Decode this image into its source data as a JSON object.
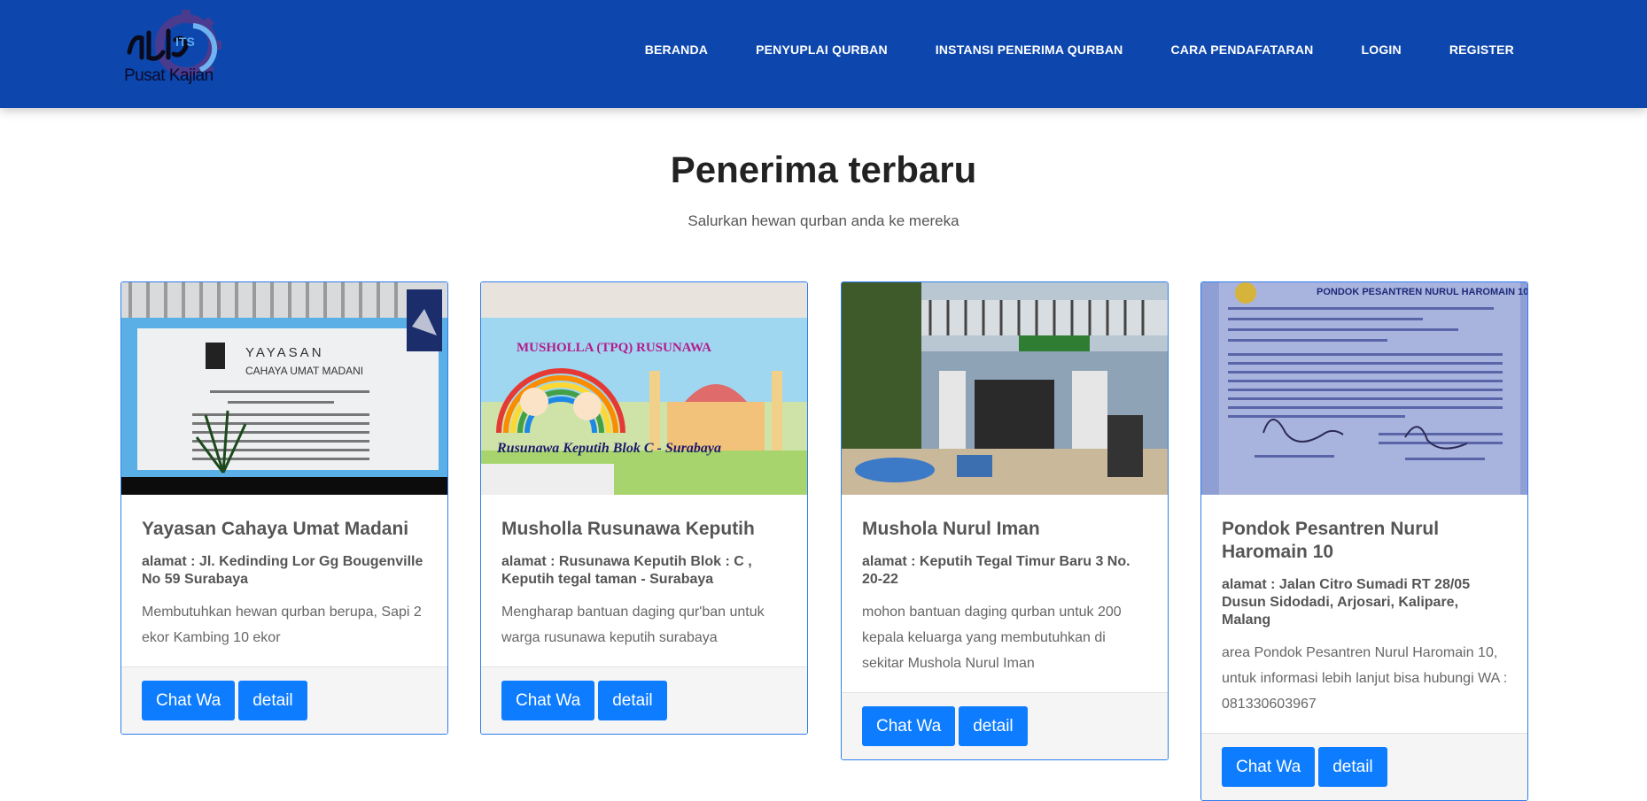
{
  "header": {
    "logo_text": "Pusat Kajian",
    "logo_badge": "ITS",
    "nav": [
      "BERANDA",
      "PENYUPLAI QURBAN",
      "INSTANSI PENERIMA QURBAN",
      "CARA PENDAFATARAN",
      "LOGIN",
      "REGISTER"
    ]
  },
  "section": {
    "title": "Penerima terbaru",
    "subtitle": "Salurkan hewan qurban anda ke mereka"
  },
  "cards": [
    {
      "title": "Yayasan Cahaya Umat Madani",
      "address": "alamat : Jl. Kedinding Lor Gg Bougenville No 59 Surabaya",
      "description": "Membutuhkan hewan qurban berupa, Sapi 2 ekor Kambing 10 ekor",
      "chat_label": "Chat Wa",
      "detail_label": "detail",
      "image_sign_title": "YAYASAN",
      "image_sign_sub": "CAHAYA UMAT MADANI"
    },
    {
      "title": "Musholla Rusunawa Keputih",
      "address": "alamat : Rusunawa Keputih Blok : C , Keputih tegal taman - Surabaya",
      "description": "Mengharap bantuan daging qur'ban untuk warga rusunawa keputih surabaya",
      "chat_label": "Chat Wa",
      "detail_label": "detail",
      "image_banner_top": "MUSHOLLA (TPQ) RUSUNAWA",
      "image_banner_bottom": "Rusunawa Keputih Blok C - Surabaya"
    },
    {
      "title": "Mushola Nurul Iman",
      "address": "alamat : Keputih Tegal Timur Baru 3 No. 20-22",
      "description": "mohon bantuan daging qurban untuk 200 kepala keluarga yang membutuhkan di sekitar Mushola Nurul Iman",
      "chat_label": "Chat Wa",
      "detail_label": "detail"
    },
    {
      "title": "Pondok Pesantren Nurul Haromain 10",
      "address": "alamat : Jalan Citro Sumadi RT 28/05 Dusun Sidodadi, Arjosari, Kalipare, Malang",
      "description": "area Pondok Pesantren Nurul Haromain 10, untuk informasi lebih lanjut bisa hubungi WA : 081330603967",
      "chat_label": "Chat Wa",
      "detail_label": "detail",
      "image_letter_head": "PONDOK PESANTREN NURUL HAROMAIN 10"
    }
  ],
  "colors": {
    "header_bg": "#0d47ad",
    "button_bg": "#0d7cff",
    "card_border": "#2f7ef0"
  }
}
